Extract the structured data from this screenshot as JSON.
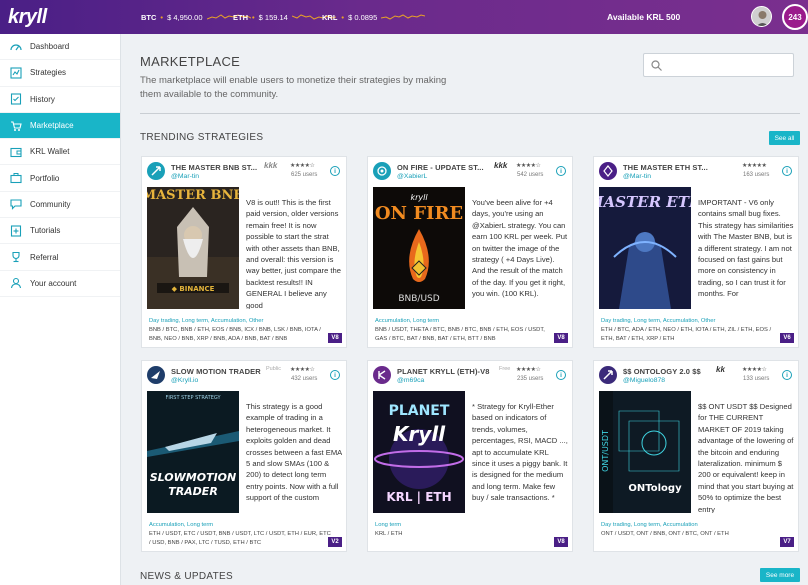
{
  "app": {
    "logo": "kryll"
  },
  "header": {
    "tickers": [
      {
        "symbol": "BTC",
        "value": "$ 4,950.00"
      },
      {
        "symbol": "ETH",
        "value": "$ 159.14"
      },
      {
        "symbol": "KRL",
        "value": "$ 0.0895"
      }
    ],
    "available": "Available KRL 500",
    "notifications": "243"
  },
  "sidebar": {
    "items": [
      {
        "label": "Dashboard",
        "icon": "dashboard-icon"
      },
      {
        "label": "Strategies",
        "icon": "strategies-icon"
      },
      {
        "label": "History",
        "icon": "history-icon"
      },
      {
        "label": "Marketplace",
        "icon": "marketplace-icon",
        "active": true
      },
      {
        "label": "KRL Wallet",
        "icon": "wallet-icon"
      },
      {
        "label": "Portfolio",
        "icon": "portfolio-icon"
      },
      {
        "label": "Community",
        "icon": "community-icon"
      },
      {
        "label": "Tutorials",
        "icon": "tutorials-icon"
      },
      {
        "label": "Referral",
        "icon": "referral-icon"
      },
      {
        "label": "Your account",
        "icon": "account-icon"
      }
    ]
  },
  "page": {
    "title": "MARKETPLACE",
    "description": "The marketplace will enable users to monetize their strategies by making them available to the community.",
    "search_placeholder": "",
    "trending_title": "TRENDING STRATEGIES",
    "see_all": "See all",
    "news_title": "NEWS & UPDATES",
    "see_more": "See more"
  },
  "colors": {
    "accent": "#19b5c8",
    "brand": "#4a1f86",
    "version_badge": "#4a1f86"
  },
  "cards": [
    {
      "title": "THE MASTER BNB ST...",
      "author": "@Mar-tin",
      "badge": "kkk",
      "stars": "★★★★☆",
      "users": "625 users",
      "cover": "MASTER BNB",
      "text": "V8 is out!! This is the first paid version, older versions remain free! It is now possible to start the strat with other assets than BNB, and overall: this version is way better, just compare the backtest results!! IN GENERAL I believe any good",
      "tags": "Day trading, Long term, Accumulation, Other",
      "pairs": "BNB / BTC, BNB / ETH, EOS / BNB, ICX / BNB, LSK / BNB, IOTA / BNB, NEO / BNB, XRP / BNB, ADA / BNB, BAT / BNB",
      "version": "V8"
    },
    {
      "title": "ON FIRE - UPDATE ST...",
      "author": "@XabierL",
      "badge": "kkk",
      "stars": "★★★★☆",
      "users": "542 users",
      "cover": "ON FIRE",
      "text": "You've been alive for +4 days, you're using an @XabierL strategy. You can earn 100 KRL per week. Put on twitter the image of the strategy ( +4 Days Live). And the result of the match of the day. If you get it right, you win. (100 KRL).",
      "tags": "Accumulation, Long term",
      "pairs": "BNB / USDT, THETA / BTC, BNB / BTC, BNB / ETH, EOS / USDT, GAS / BTC, BAT / BNB, BAT / ETH, BTT / BNB",
      "version": "V8"
    },
    {
      "title": "THE MASTER ETH ST...",
      "author": "@Mar-tin",
      "badge": "",
      "stars": "★★★★★",
      "users": "163 users",
      "cover": "MASTER ETH",
      "text": "IMPORTANT - V6 only contains small bug fixes. This strategy has similarities with The Master BNB, but is a different strategy. I am not focused on fast gains but more on consistency in trading, so I can trust it for months. For",
      "tags": "Day trading, Long term, Accumulation, Other",
      "pairs": "ETH / BTC, ADA / ETH, NEO / ETH, IOTA / ETH, ZIL / ETH, EOS / ETH, BAT / ETH, XRP / ETH",
      "version": "V6"
    },
    {
      "title": "SLOW MOTION TRADER",
      "author": "@Kryll.io",
      "badge": "",
      "public": "Public",
      "stars": "★★★★☆",
      "users": "432 users",
      "cover": "SLOWMOTION TRADER",
      "text": "This strategy is a good example of trading in a heterogeneous market. It exploits golden and dead crosses between a fast EMA 5 and slow SMAs (100 & 200) to detect long term entry points. Now with a full support of the custom",
      "tags": "Accumulation, Long term",
      "pairs": "ETH / USDT, ETC / USDT, BNB / USDT, LTC / USDT, ETH / EUR, ETC / USD, BNB / PAX, LTC / TUSD, ETH / BTC",
      "version": "V2"
    },
    {
      "title": "PLANET KRYLL (ETH)-V8",
      "author": "@m69ca",
      "badge": "",
      "public": "Free",
      "stars": "★★★★☆",
      "users": "235 users",
      "cover": "PLANET Kryll",
      "text": "* Strategy for Kryll-Ether based on indicators of trends, volumes, percentages, RSI, MACD ..., apt to accumulate KRL since it uses a piggy bank. It is designed for the medium and long term. Make few buy / sale transactions. *",
      "tags": "Long term",
      "pairs": "KRL / ETH",
      "version": "V8"
    },
    {
      "title": "$$ ONTOLOGY 2.0 $$",
      "author": "@Miguelo878",
      "badge": "kk",
      "stars": "★★★★☆",
      "users": "133 users",
      "cover": "ONTology",
      "text": "$$ ONT USDT $$ Designed for THE CURRENT MARKET OF 2019 taking advantage of the lowering of the bitcoin and enduring lateralization. minimum $ 200 or equivalent! keep in mind that you start buying at 50% to optimize the best entry",
      "tags": "Day trading, Long term, Accumulation",
      "pairs": "ONT / USDT, ONT / BNB, ONT / BTC, ONT / ETH",
      "version": "V7"
    }
  ]
}
